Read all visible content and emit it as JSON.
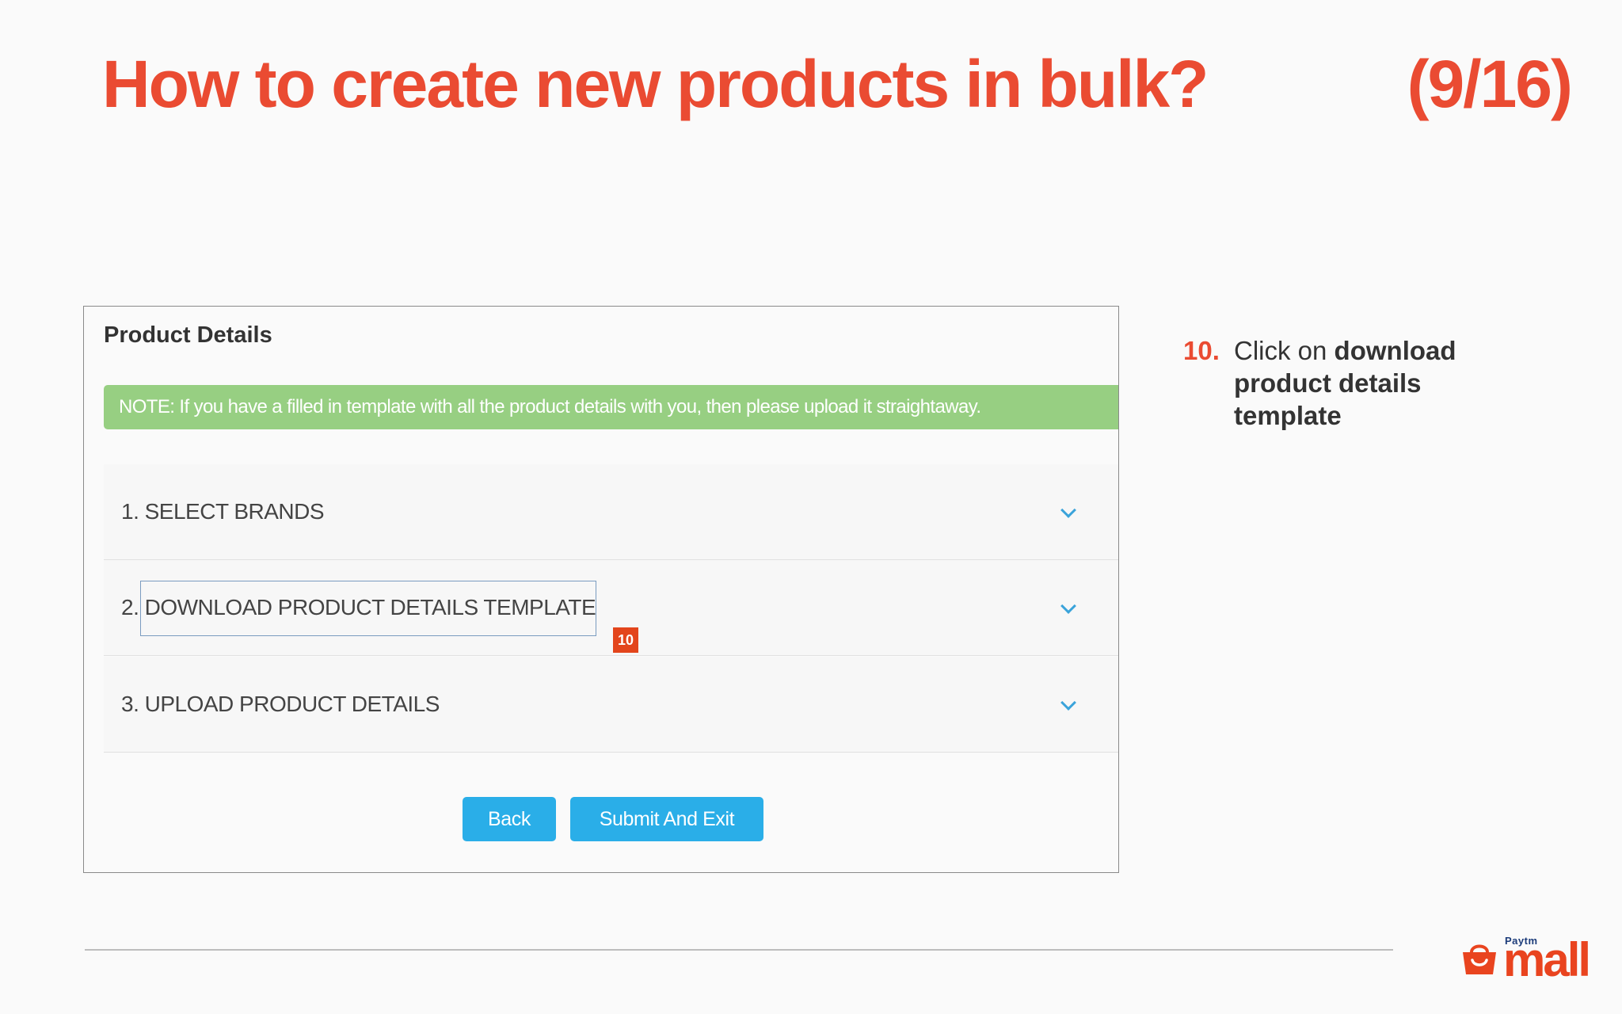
{
  "slide": {
    "title": "How to create new products in bulk?",
    "counter": "(9/16)"
  },
  "panel": {
    "title": "Product Details",
    "note": "NOTE: If you have a filled in template with all the product details with you, then please upload it straightaway.",
    "steps": [
      {
        "label": "1. SELECT BRANDS"
      },
      {
        "label": "2. DOWNLOAD PRODUCT DETAILS TEMPLATE"
      },
      {
        "label": "3. UPLOAD PRODUCT DETAILS"
      }
    ],
    "step_marker": "10",
    "buttons": {
      "back": "Back",
      "submit": "Submit And Exit"
    }
  },
  "instruction": {
    "number": "10.",
    "prefix": "Click on ",
    "emphasis": "download product details template"
  },
  "logo": {
    "small": "Paytm",
    "word": "mall"
  },
  "colors": {
    "accent": "#ea4b32",
    "note_bg": "#97cf82",
    "button": "#2aaee8",
    "chevron": "#3aa3da"
  },
  "icons": [
    "chevron-down-icon",
    "shopping-bag-icon"
  ]
}
